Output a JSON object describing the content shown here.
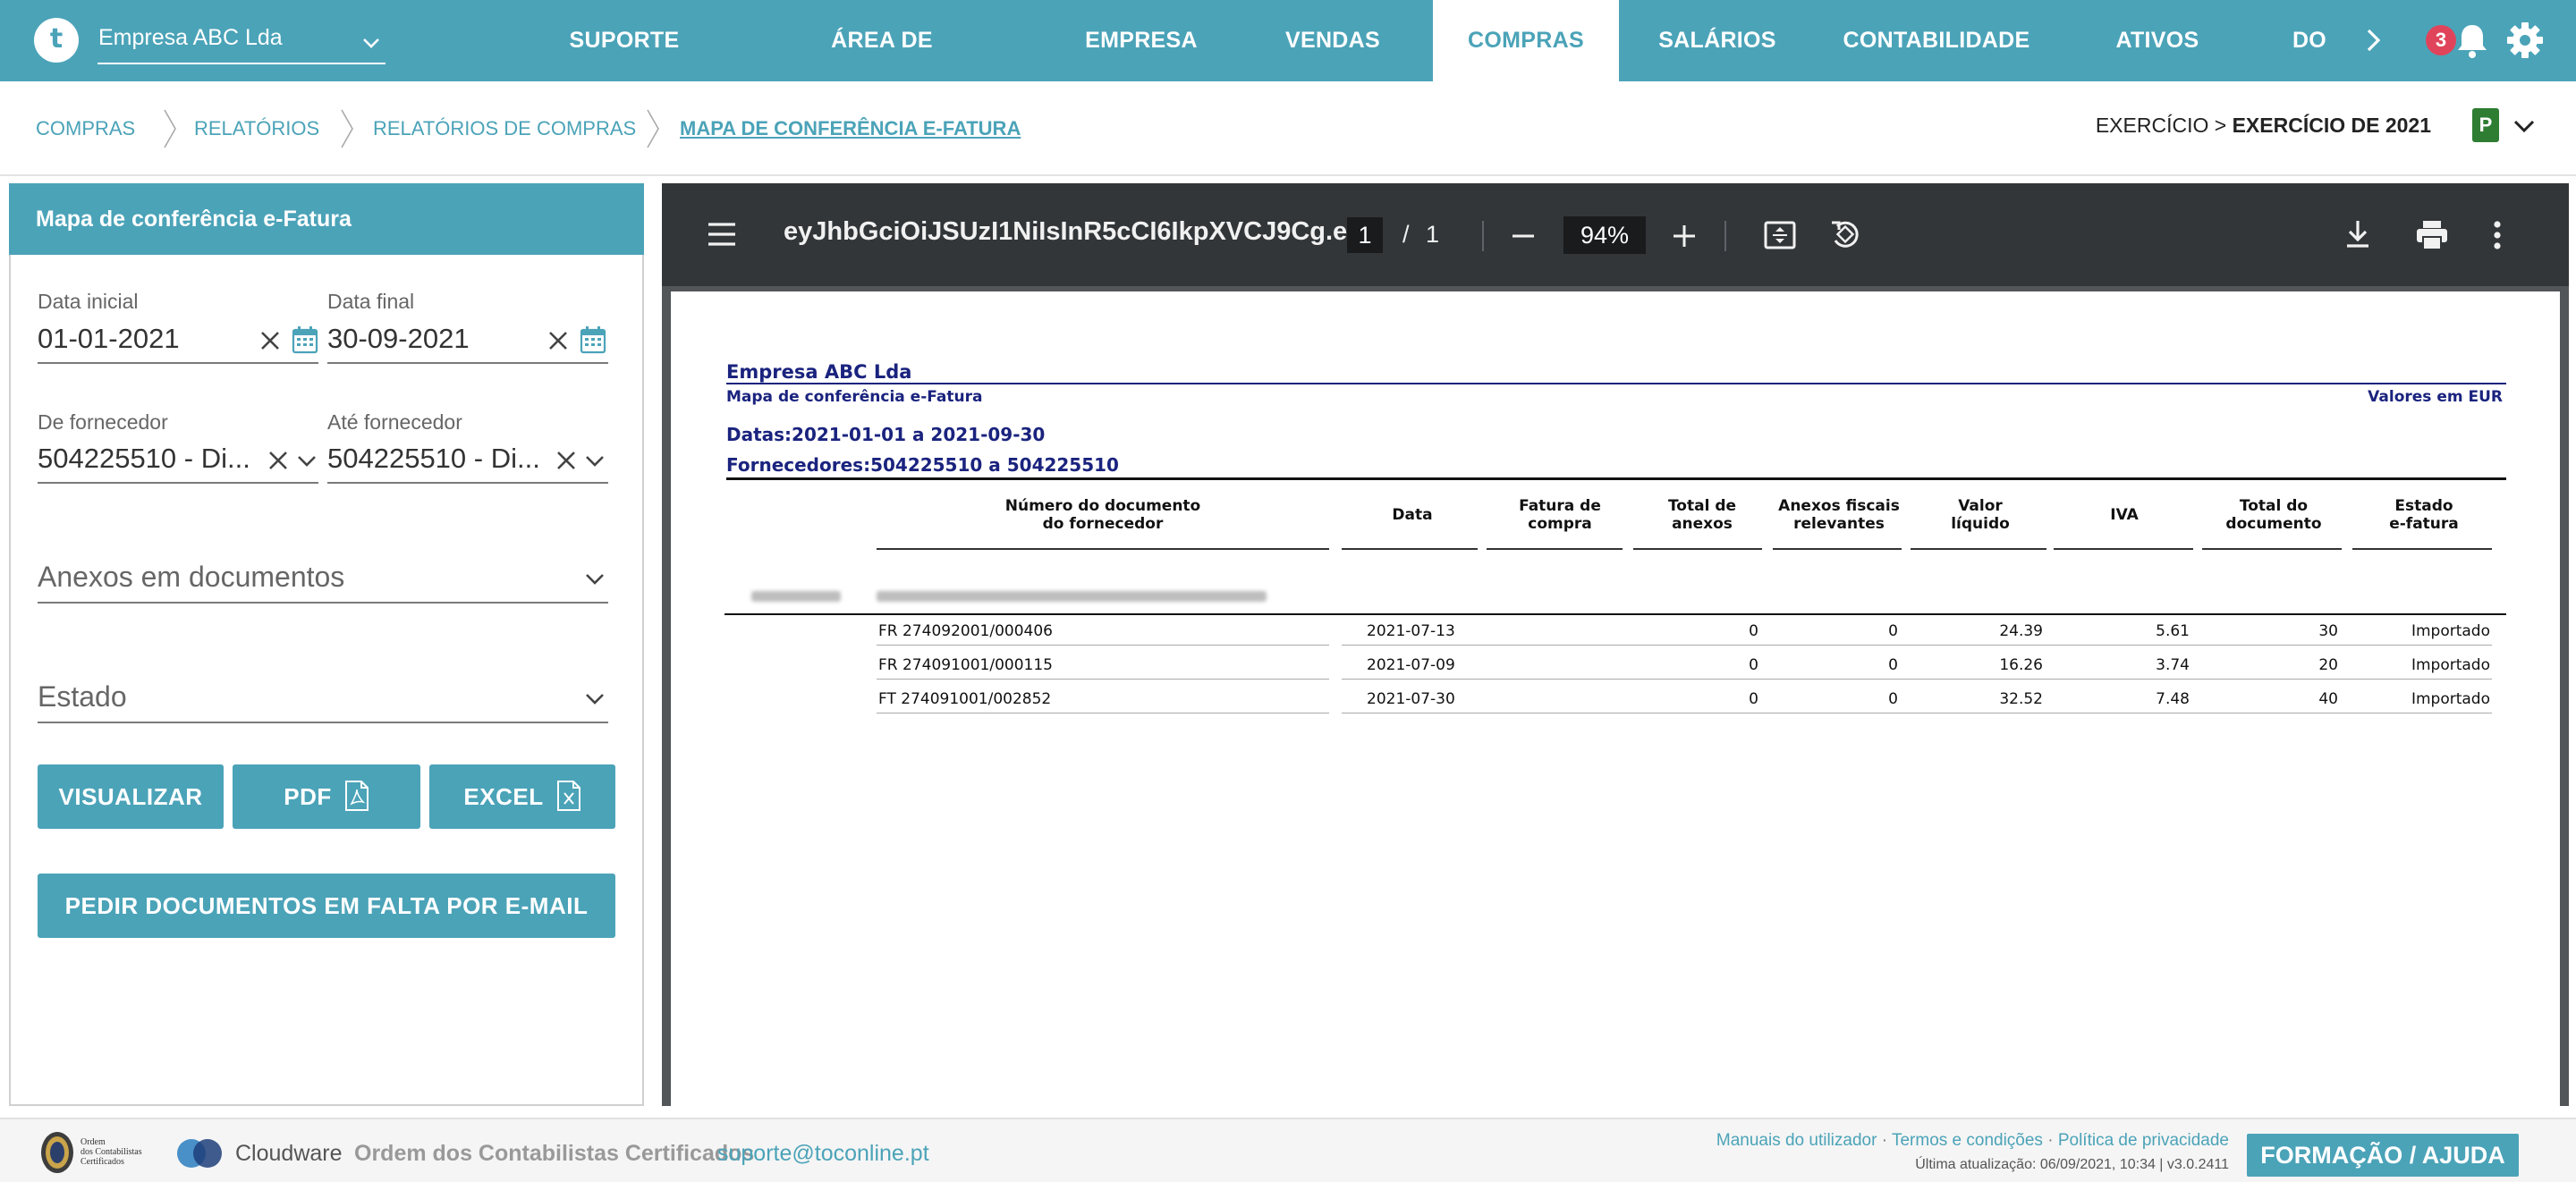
{
  "app": {
    "logo_letter": "t",
    "company": "Empresa ABC Lda",
    "menu": [
      "SUPORTE",
      "ÁREA DE CONTABILISTA",
      "EMPRESA",
      "VENDAS",
      "COMPRAS",
      "SALÁRIOS",
      "CONTABILIDADE",
      "ATIVOS",
      "DO"
    ],
    "active_menu": "COMPRAS",
    "notifications_count": "3"
  },
  "breadcrumb": {
    "items": [
      "COMPRAS",
      "RELATÓRIOS",
      "RELATÓRIOS DE COMPRAS",
      "MAPA DE CONFERÊNCIA E-FATURA"
    ],
    "exercise_prefix": "EXERCÍCIO > ",
    "exercise_value": "EXERCÍCIO DE 2021",
    "exercise_badge": "P"
  },
  "panel": {
    "title": "Mapa de conferência e-Fatura",
    "start_date_label": "Data inicial",
    "start_date_value": "01-01-2021",
    "end_date_label": "Data final",
    "end_date_value": "30-09-2021",
    "from_supplier_label": "De fornecedor",
    "from_supplier_value": "504225510 - Di...",
    "to_supplier_label": "Até fornecedor",
    "to_supplier_value": "504225510 - Di...",
    "attachments_placeholder": "Anexos em documentos",
    "state_placeholder": "Estado",
    "btn_view": "VISUALIZAR",
    "btn_pdf": "PDF",
    "btn_excel": "EXCEL",
    "btn_request": "PEDIR DOCUMENTOS EM FALTA POR E-MAIL"
  },
  "viewer": {
    "file_title": "eyJhbGciOiJSUzI1NiIsInR5cCI6IkpXVCJ9Cg.e...",
    "page_current": "1",
    "page_sep": "/",
    "page_total": "1",
    "zoom": "94%"
  },
  "report": {
    "company": "Empresa ABC Lda",
    "subtitle": "Mapa de conferência e-Fatura",
    "currency_note": "Valores em EUR",
    "dates": "Datas:2021-01-01 a 2021-09-30",
    "suppliers": "Fornecedores:504225510 a 504225510",
    "headers": [
      {
        "l1": "Número do documento",
        "l2": "do fornecedor"
      },
      {
        "l1": "Data",
        "l2": ""
      },
      {
        "l1": "Fatura de",
        "l2": "compra"
      },
      {
        "l1": "Total de",
        "l2": "anexos"
      },
      {
        "l1": "Anexos fiscais",
        "l2": "relevantes"
      },
      {
        "l1": "Valor",
        "l2": "líquido"
      },
      {
        "l1": "IVA",
        "l2": ""
      },
      {
        "l1": "Total do",
        "l2": "documento"
      },
      {
        "l1": "Estado",
        "l2": "e-fatura"
      }
    ],
    "rows": [
      {
        "doc": "FR 274092001/000406",
        "date": "2021-07-13",
        "invoice": "",
        "total_att": "0",
        "fiscal_att": "0",
        "net": "24.39",
        "vat": "5.61",
        "total": "30",
        "state": "Importado"
      },
      {
        "doc": "FR 274091001/000115",
        "date": "2021-07-09",
        "invoice": "",
        "total_att": "0",
        "fiscal_att": "0",
        "net": "16.26",
        "vat": "3.74",
        "total": "20",
        "state": "Importado"
      },
      {
        "doc": "FT 274091001/002852",
        "date": "2021-07-30",
        "invoice": "",
        "total_att": "0",
        "fiscal_att": "0",
        "net": "32.52",
        "vat": "7.48",
        "total": "40",
        "state": "Importado"
      }
    ]
  },
  "footer": {
    "ordem_l1": "Ordem",
    "ordem_l2": "dos Contabilistas",
    "ordem_l3": "Certificados",
    "cloudware": "Cloudware",
    "occ": "Ordem dos Contabilistas Certificados",
    "email": "suporte@toconline.pt",
    "link_manuals": "Manuais do utilizador",
    "link_terms": "Termos e condições",
    "link_privacy": "Política de privacidade",
    "link_sep": " · ",
    "last_update": "Última atualização: 06/09/2021, 10:34 | v3.0.2411",
    "help_button": "FORMAÇÃO / AJUDA"
  },
  "colors": {
    "brand": "#4ba3b8",
    "viewer_toolbar": "#323639",
    "report_blue": "#1a237e",
    "badge_red": "#e0445a",
    "exercise_green": "#2e7d32"
  },
  "icons": [
    "chevron-down-icon",
    "chevron-right-icon",
    "bell-icon",
    "gear-icon",
    "clear-icon",
    "calendar-icon",
    "pdf-file-icon",
    "excel-file-icon",
    "hamburger-icon",
    "minus-icon",
    "plus-icon",
    "fit-page-icon",
    "rotate-icon",
    "download-icon",
    "print-icon",
    "more-vert-icon"
  ]
}
